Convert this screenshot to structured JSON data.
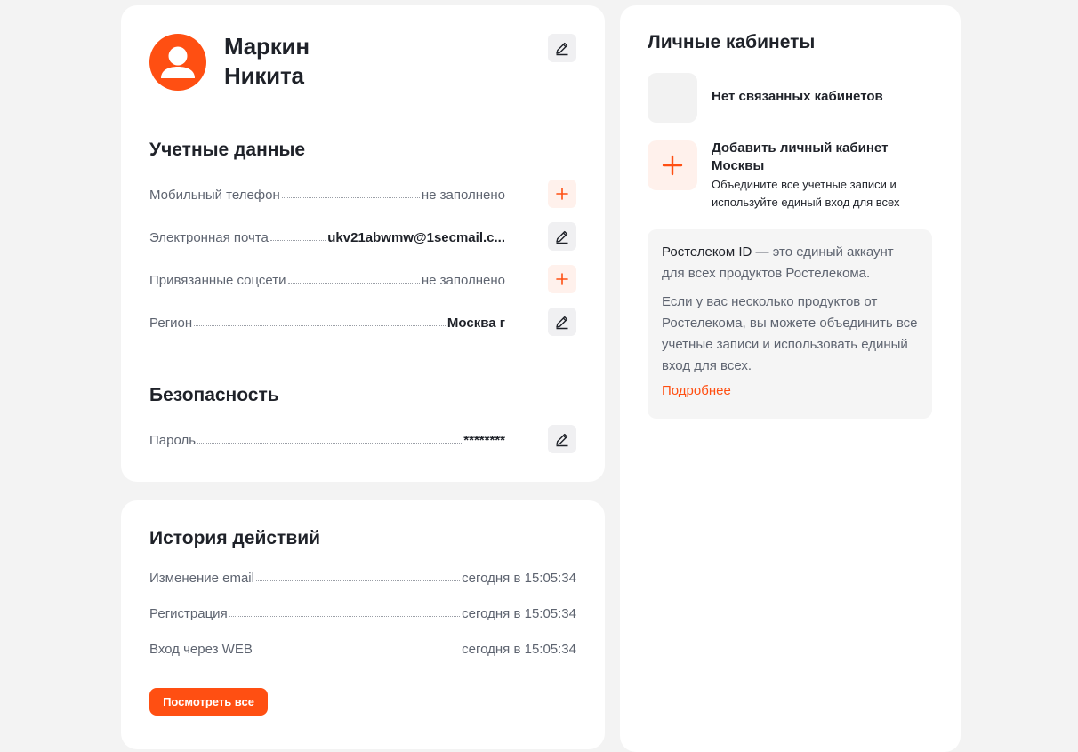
{
  "profile": {
    "first_line": "Маркин",
    "second_line": "Никита"
  },
  "credentials": {
    "title": "Учетные данные",
    "rows": [
      {
        "label": "Мобильный телефон",
        "value": "не заполнено",
        "action": "plus-icon"
      },
      {
        "label": "Электронная почта",
        "value": "ukv21abwmw@1secmail.c...",
        "action": "pencil-icon"
      },
      {
        "label": "Привязанные соцсети",
        "value": "не заполнено",
        "action": "plus-icon"
      },
      {
        "label": "Регион",
        "value": "Москва г",
        "action": "pencil-icon"
      }
    ]
  },
  "security": {
    "title": "Безопасность",
    "rows": [
      {
        "label": "Пароль",
        "value": "********",
        "action": "pencil-icon"
      }
    ]
  },
  "history": {
    "title": "История действий",
    "rows": [
      {
        "label": "Изменение email",
        "value": "сегодня в 15:05:34"
      },
      {
        "label": "Регистрация",
        "value": "сегодня в 15:05:34"
      },
      {
        "label": "Вход через WEB",
        "value": "сегодня в 15:05:34"
      }
    ],
    "view_all_label": "Посмотреть все"
  },
  "accounts": {
    "title": "Личные кабинеты",
    "none_text": "Нет связанных кабинетов",
    "add_title": "Добавить личный кабинет Москвы",
    "add_description": "Объедините все учетные записи и используйте единый вход для всех",
    "info": {
      "brand": "Ростелеком ID",
      "lead": " — это единый аккаунт для всех продуктов Ростелекома.",
      "body": "Если у вас несколько продуктов от Ростелекома, вы можете объединить все учетные записи и использовать единый вход для всех.",
      "link": "Подробнее"
    }
  },
  "colors": {
    "accent": "#ff4f12",
    "accent_soft": "#fff1ec",
    "background": "#f3f3f3",
    "text": "#1f2229",
    "muted_text": "#5e6470"
  }
}
